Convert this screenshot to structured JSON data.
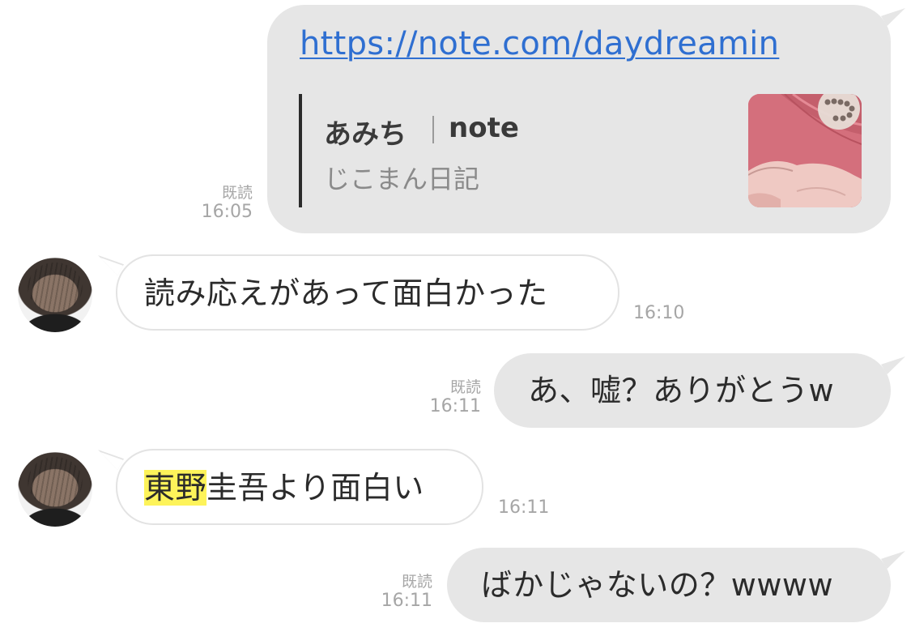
{
  "messages": [
    {
      "id": "m1",
      "direction": "outgoing",
      "link_url": "https://note.com/daydreamin",
      "preview_title_part1": "あみち",
      "preview_title_part2": "note",
      "preview_description": "じこまん日記",
      "thumbnail_icon": "note-thumbnail-image",
      "read_label": "既読",
      "time": "16:05"
    },
    {
      "id": "m2",
      "direction": "incoming",
      "text": "読み応えがあって面白かった",
      "time": "16:10"
    },
    {
      "id": "m3",
      "direction": "outgoing",
      "text": "あ、嘘？ありがとうw",
      "read_label": "既読",
      "time": "16:11"
    },
    {
      "id": "m4",
      "direction": "incoming",
      "text_highlighted": "東野",
      "text_rest": "圭吾より面白い",
      "highlight_color": "#fdf35a",
      "time": "16:11"
    },
    {
      "id": "m5",
      "direction": "outgoing",
      "text": "ばかじゃないの？wwww",
      "read_label": "既読",
      "time": "16:11"
    }
  ],
  "colors": {
    "outgoing_bubble": "#e6e6e6",
    "incoming_bubble": "#ffffff",
    "link": "#2f6fd1",
    "meta_text": "#a6a6a6"
  }
}
